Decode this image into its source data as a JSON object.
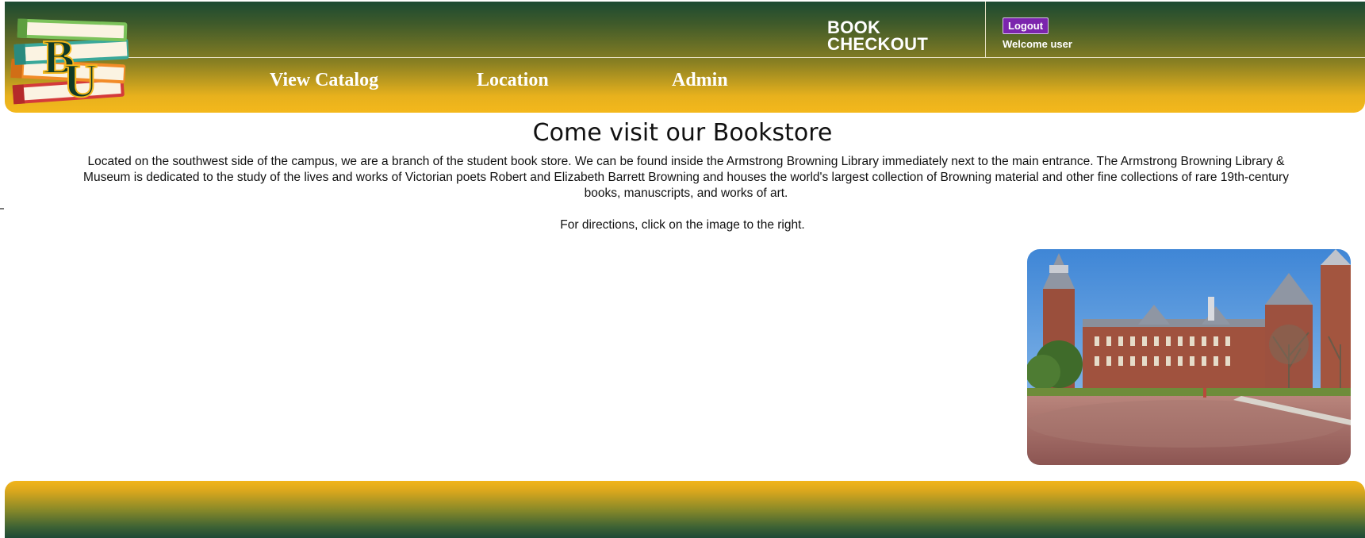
{
  "app": {
    "title_line1": "BOOK",
    "title_line2": "CHECKOUT",
    "logo_letters": "BU"
  },
  "account": {
    "logout_label": "Logout",
    "welcome_text": "Welcome user"
  },
  "nav": {
    "items": [
      {
        "label": "View Catalog",
        "icon": null
      },
      {
        "label": "Location",
        "icon": null
      },
      {
        "label": "Admin",
        "icon": null
      }
    ]
  },
  "main": {
    "heading": "Come visit our Bookstore",
    "intro": "Located on the southwest side of the campus, we are a branch of the student book store. We can be found inside the Armstrong Browning Library immediately next to the main entrance. The Armstrong Browning Library & Museum is dedicated to the study of the lives and works of Victorian poets Robert and Elizabeth Barrett Browning and houses the world's largest collection of Browning material and other fine collections of rare 19th-century books, manuscripts, and works of art.",
    "directions": "For directions, click on the image to the right."
  },
  "colors": {
    "brand_green": "#1c4a32",
    "brand_gold": "#f4b81c",
    "logout_purple": "#7b25ad"
  }
}
